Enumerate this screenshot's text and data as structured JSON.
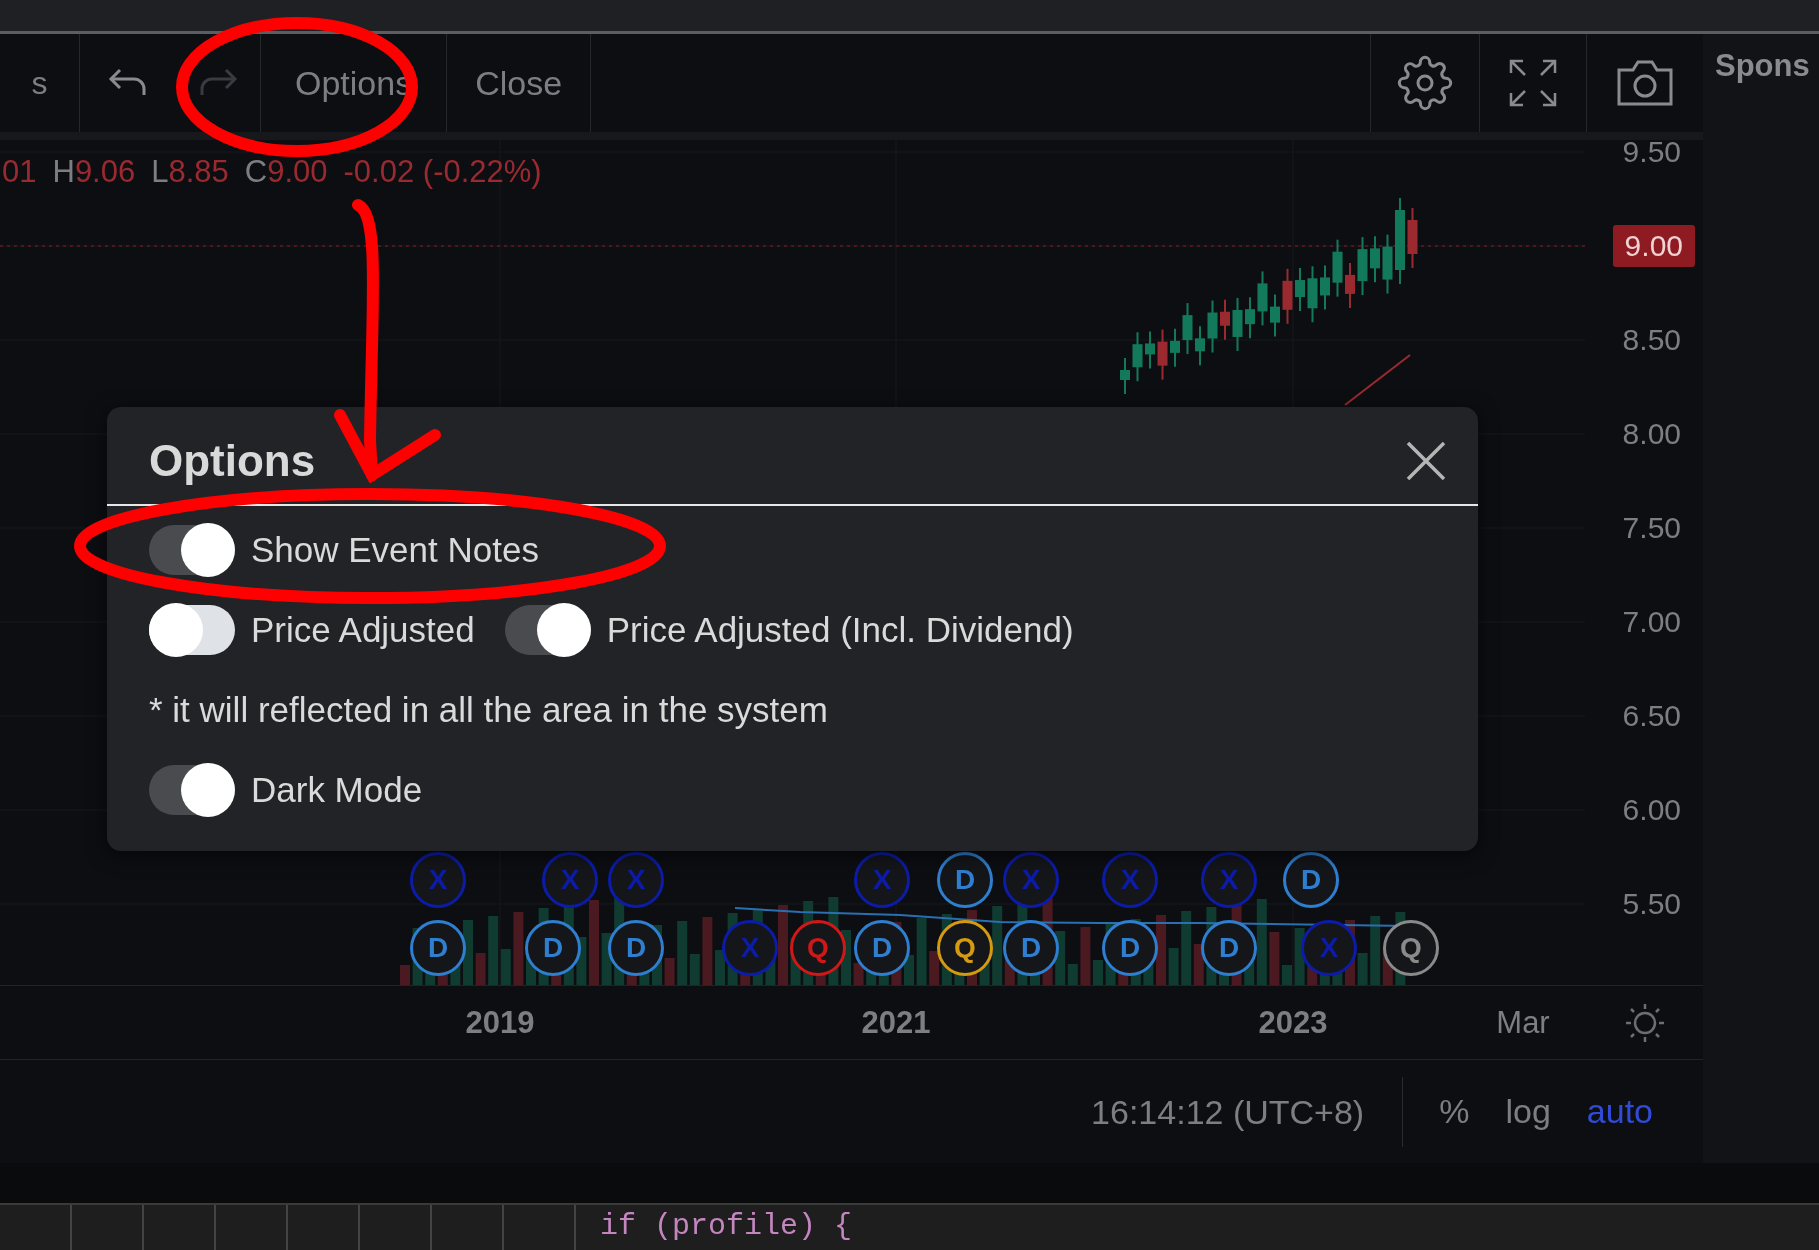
{
  "toolbar": {
    "cut_label": "s",
    "items": [
      {
        "label": "Options"
      },
      {
        "label": "Close"
      }
    ]
  },
  "sidebar": {
    "title": "Spons"
  },
  "legend": {
    "head": "01",
    "values": [
      {
        "key": "H",
        "value": "9.06"
      },
      {
        "key": "L",
        "value": "8.85"
      },
      {
        "key": "C",
        "value": "9.00"
      }
    ],
    "change": "-0.02 (-0.22%)"
  },
  "price_axis": {
    "labels": [
      {
        "text": "9.50",
        "kind": "plain"
      },
      {
        "text": "9.00",
        "kind": "badge"
      },
      {
        "text": "8.50",
        "kind": "plain"
      },
      {
        "text": "8.00",
        "kind": "plain"
      },
      {
        "text": "7.50",
        "kind": "plain"
      },
      {
        "text": "7.00",
        "kind": "plain"
      },
      {
        "text": "6.50",
        "kind": "plain"
      },
      {
        "text": "6.00",
        "kind": "plain"
      },
      {
        "text": "5.50",
        "kind": "plain"
      }
    ]
  },
  "events": {
    "upper": [
      {
        "label": "X",
        "color": "#0c1ca8"
      },
      {
        "label": "X",
        "color": "#0c1ca8"
      },
      {
        "label": "X",
        "color": "#0c1ca8"
      },
      {
        "label": "X",
        "color": "#0c1ca8"
      },
      {
        "label": "D",
        "color": "#2f7fd0"
      },
      {
        "label": "X",
        "color": "#0c1ca8"
      },
      {
        "label": "X",
        "color": "#0c1ca8"
      },
      {
        "label": "X",
        "color": "#0c1ca8"
      },
      {
        "label": "D",
        "color": "#2f7fd0"
      }
    ],
    "lower": [
      {
        "label": "D",
        "color": "#2f7fd0"
      },
      {
        "label": "D",
        "color": "#2f7fd0"
      },
      {
        "label": "D",
        "color": "#2f7fd0"
      },
      {
        "label": "X",
        "color": "#0c1ca8"
      },
      {
        "label": "Q",
        "color": "#d01818"
      },
      {
        "label": "D",
        "color": "#2f7fd0"
      },
      {
        "label": "Q",
        "color": "#d49a10"
      },
      {
        "label": "D",
        "color": "#2f7fd0"
      },
      {
        "label": "D",
        "color": "#2f7fd0"
      },
      {
        "label": "D",
        "color": "#2f7fd0"
      },
      {
        "label": "X",
        "color": "#0c1ca8"
      },
      {
        "label": "Q",
        "color": "#8a8a8a"
      }
    ]
  },
  "time_axis": {
    "labels": [
      "2019",
      "2021",
      "2023",
      "Mar"
    ]
  },
  "status_bar": {
    "time": "16:14:12 (UTC+8)",
    "buttons": [
      {
        "label": "%",
        "selected": false
      },
      {
        "label": "log",
        "selected": false
      },
      {
        "label": "auto",
        "selected": true
      }
    ]
  },
  "dialog": {
    "title": "Options",
    "rows": [
      {
        "kind": "toggles",
        "toggles": [
          {
            "label": "Show Event Notes",
            "on": true
          }
        ]
      },
      {
        "kind": "toggles",
        "toggles": [
          {
            "label": "Price Adjusted",
            "on": false
          },
          {
            "label": "Price Adjusted (Incl. Dividend)",
            "on": true
          }
        ]
      },
      {
        "kind": "note",
        "text": "* it will reflected in all the area in the system"
      },
      {
        "kind": "toggles",
        "toggles": [
          {
            "label": "Dark Mode",
            "on": true
          }
        ]
      }
    ]
  },
  "editor": {
    "code": "if (profile) {"
  },
  "annotations": [
    {
      "kind": "ring"
    },
    {
      "kind": "arrow"
    },
    {
      "kind": "ring"
    }
  ]
}
